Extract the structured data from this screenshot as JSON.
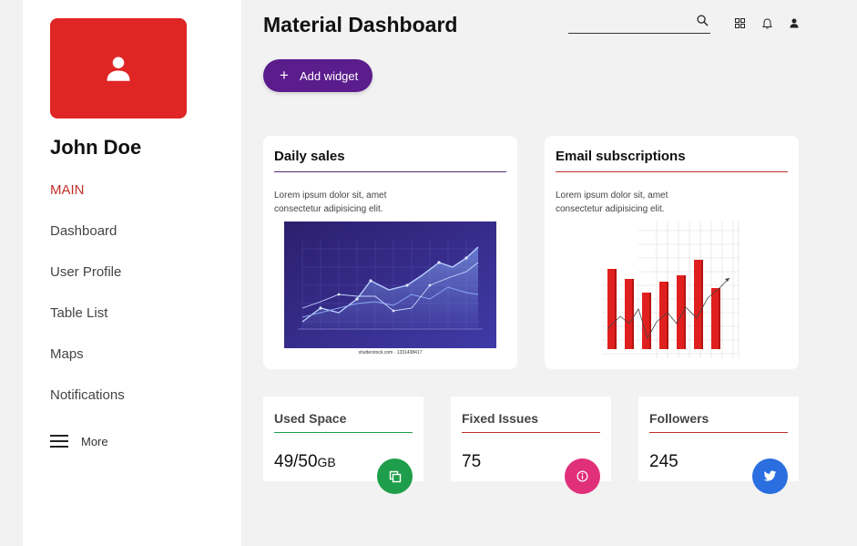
{
  "sidebar": {
    "user_name": "John Doe",
    "section_label": "MAIN",
    "items": [
      {
        "label": "Dashboard"
      },
      {
        "label": "User Profile"
      },
      {
        "label": "Table List"
      },
      {
        "label": "Maps"
      },
      {
        "label": "Notifications"
      }
    ],
    "more_label": "More"
  },
  "header": {
    "title": "Material Dashboard",
    "search_value": "",
    "icons": [
      "search-icon",
      "apps-grid-icon",
      "bell-icon",
      "user-icon"
    ]
  },
  "toolbar": {
    "add_widget_label": "Add widget"
  },
  "cards": [
    {
      "title": "Daily sales",
      "text": "Lorem ipsum dolor sit, amet consectetur adipisicing elit.",
      "image_caption": "shutterstock.com · 1331438417",
      "rule_color": "#5b2a7a"
    },
    {
      "title": "Email subscriptions",
      "text": "Lorem ipsum dolor sit, amet consectetur adipisicing elit.",
      "rule_color": "#c0302a"
    }
  ],
  "stats": [
    {
      "title": "Used Space",
      "value": "49/50",
      "unit": "GB",
      "color": "#1e9e4a",
      "icon": "copy-icon"
    },
    {
      "title": "Fixed Issues",
      "value": "75",
      "unit": "",
      "color": "#e0307a",
      "icon": "info-icon"
    },
    {
      "title": "Followers",
      "value": "245",
      "unit": "",
      "color": "#2a6ee0",
      "icon": "twitter-icon"
    }
  ],
  "colors": {
    "accent": "#e02525",
    "primary": "#5b1c8c",
    "active_nav": "#c0302a"
  }
}
